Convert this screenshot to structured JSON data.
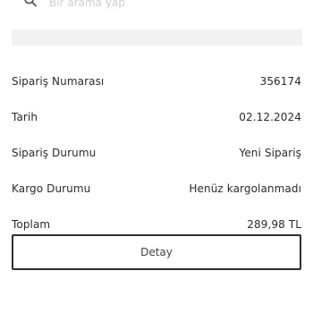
{
  "search": {
    "icon": "search-icon",
    "placeholder": "Bir arama yap"
  },
  "order": {
    "rows": [
      {
        "label": "Sipariş Numarası",
        "value": "356174"
      },
      {
        "label": "Tarih",
        "value": "02.12.2024"
      },
      {
        "label": "Sipariş Durumu",
        "value": "Yeni Sipariş"
      },
      {
        "label": "Kargo Durumu",
        "value": "Henüz kargolanmadı"
      },
      {
        "label": "Toplam",
        "value": "289,98 TL"
      }
    ]
  },
  "actions": {
    "detail_label": "Detay"
  }
}
